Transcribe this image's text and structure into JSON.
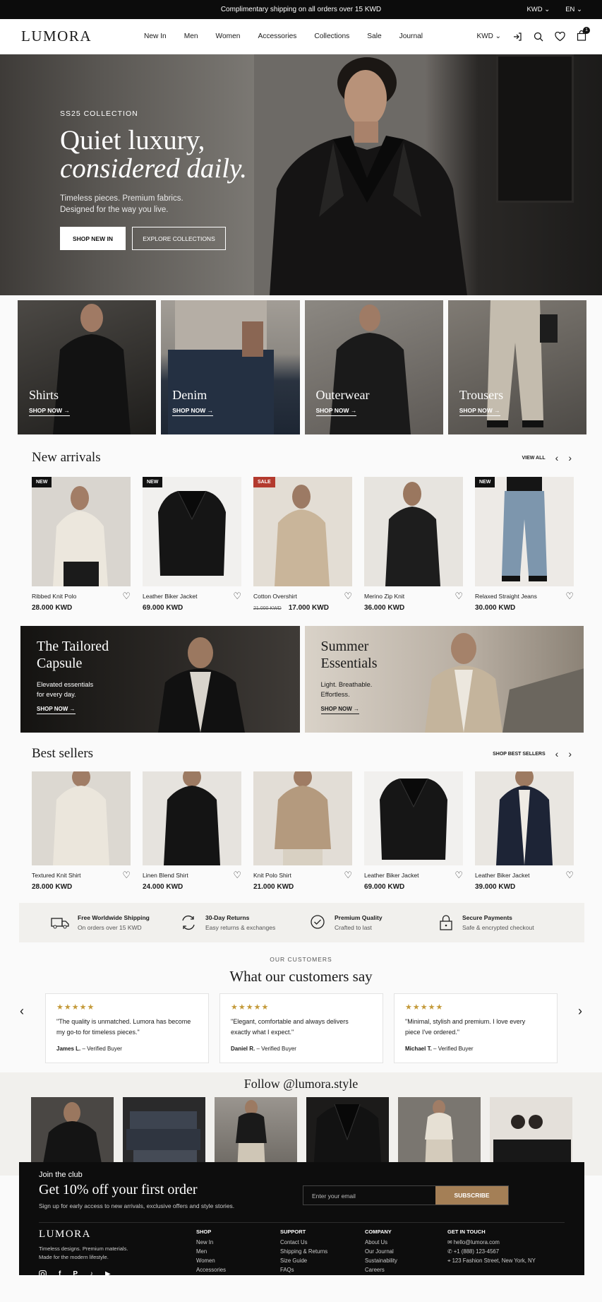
{
  "topbar": {
    "message": "Complimentary shipping on all orders over 15 KWD",
    "currency": "KWD ⌄",
    "language": "EN ⌄"
  },
  "header": {
    "logo": "LUMORA",
    "nav": [
      "New In",
      "Men",
      "Women",
      "Accessories",
      "Collections",
      "Sale",
      "Journal"
    ],
    "currency": "KWD ⌄",
    "cart_count": "1"
  },
  "hero": {
    "eyebrow": "SS25 COLLECTION",
    "title_line1": "Quiet luxury,",
    "title_line2": "considered daily.",
    "subtitle_line1": "Timeless pieces. Premium fabrics.",
    "subtitle_line2": "Designed for the way you live.",
    "primary_cta": "SHOP NEW IN",
    "secondary_cta": "EXPLORE COLLECTIONS"
  },
  "categories": [
    {
      "title": "Shirts",
      "link": "SHOP NOW →"
    },
    {
      "title": "Denim",
      "link": "SHOP NOW →"
    },
    {
      "title": "Outerwear",
      "link": "SHOP NOW →"
    },
    {
      "title": "Trousers",
      "link": "SHOP NOW →"
    }
  ],
  "new_arrivals": {
    "title": "New arrivals",
    "view_all": "VIEW ALL",
    "products": [
      {
        "badge": "NEW",
        "name": "Ribbed Knit Polo",
        "price": "28.000 KWD",
        "old_price": ""
      },
      {
        "badge": "NEW",
        "name": "Leather Biker Jacket",
        "price": "69.000 KWD",
        "old_price": ""
      },
      {
        "badge": "SALE",
        "name": "Cotton Overshirt",
        "price": "17.000 KWD",
        "old_price": "21.000 KWD"
      },
      {
        "badge": "",
        "name": "Merino Zip Knit",
        "price": "36.000 KWD",
        "old_price": ""
      },
      {
        "badge": "NEW",
        "name": "Relaxed Straight Jeans",
        "price": "30.000 KWD",
        "old_price": ""
      }
    ]
  },
  "promos": [
    {
      "title_line1": "The Tailored",
      "title_line2": "Capsule",
      "text_line1": "Elevated essentials",
      "text_line2": "for every day.",
      "link": "SHOP NOW →"
    },
    {
      "title_line1": "Summer",
      "title_line2": "Essentials",
      "text_line1": "Light. Breathable.",
      "text_line2": "Effortless.",
      "link": "SHOP NOW →"
    }
  ],
  "best_sellers": {
    "title": "Best sellers",
    "link": "SHOP BEST SELLERS",
    "products": [
      {
        "name": "Textured Knit Shirt",
        "price": "28.000 KWD"
      },
      {
        "name": "Linen Blend Shirt",
        "price": "24.000 KWD"
      },
      {
        "name": "Knit Polo Shirt",
        "price": "21.000 KWD"
      },
      {
        "name": "Leather Biker Jacket",
        "price": "69.000 KWD"
      },
      {
        "name": "Leather Biker Jacket",
        "price": "39.000 KWD"
      }
    ]
  },
  "features": [
    {
      "icon": "truck-icon",
      "title": "Free Worldwide Shipping",
      "text": "On orders over 15 KWD"
    },
    {
      "icon": "returns-icon",
      "title": "30-Day Returns",
      "text": "Easy returns & exchanges"
    },
    {
      "icon": "quality-badge-icon",
      "title": "Premium Quality",
      "text": "Crafted to last"
    },
    {
      "icon": "lock-icon",
      "title": "Secure Payments",
      "text": "Safe & encrypted checkout"
    }
  ],
  "testimonials": {
    "eyebrow": "OUR CUSTOMERS",
    "title": "What our customers say",
    "items": [
      {
        "stars": "★★★★★",
        "quote_line1": "\"The quality is unmatched. Lumora has become",
        "quote_line2": "my go-to for timeless pieces.\"",
        "author": "James L.",
        "verified": " – Verified Buyer"
      },
      {
        "stars": "★★★★★",
        "quote_line1": "\"Elegant, comfortable and always delivers",
        "quote_line2": "exactly what I expect.\"",
        "author": "Daniel R.",
        "verified": " – Verified Buyer"
      },
      {
        "stars": "★★★★★",
        "quote_line1": "\"Minimal, stylish and premium. I love every",
        "quote_line2": "piece I've ordered.\"",
        "author": "Michael T.",
        "verified": " – Verified Buyer"
      }
    ]
  },
  "instagram": {
    "title": "Follow @lumora.style"
  },
  "newsletter": {
    "eyebrow": "Join the club",
    "title": "Get 10% off your first order",
    "text": "Sign up for early access to new arrivals, exclusive offers and style stories.",
    "placeholder": "Enter your email",
    "button": "SUBSCRIBE"
  },
  "footer": {
    "logo": "LUMORA",
    "tagline_line1": "Timeless designs. Premium materials.",
    "tagline_line2": "Made for the modern lifestyle.",
    "shop": {
      "title": "SHOP",
      "links": [
        "New In",
        "Men",
        "Women",
        "Accessories"
      ]
    },
    "support": {
      "title": "SUPPORT",
      "links": [
        "Contact Us",
        "Shipping & Returns",
        "Size Guide",
        "FAQs"
      ]
    },
    "company": {
      "title": "COMPANY",
      "links": [
        "About Us",
        "Our Journal",
        "Sustainability",
        "Careers"
      ]
    },
    "contact": {
      "title": "GET IN TOUCH",
      "email": "hello@lumora.com",
      "phone": "+1 (888) 123-4567",
      "address": "123 Fashion Street, New York, NY"
    }
  },
  "colors": {
    "accent": "#a47f56",
    "sale": "#b33a2e",
    "stars": "#c49a3a",
    "dark": "#0d0d0d"
  }
}
